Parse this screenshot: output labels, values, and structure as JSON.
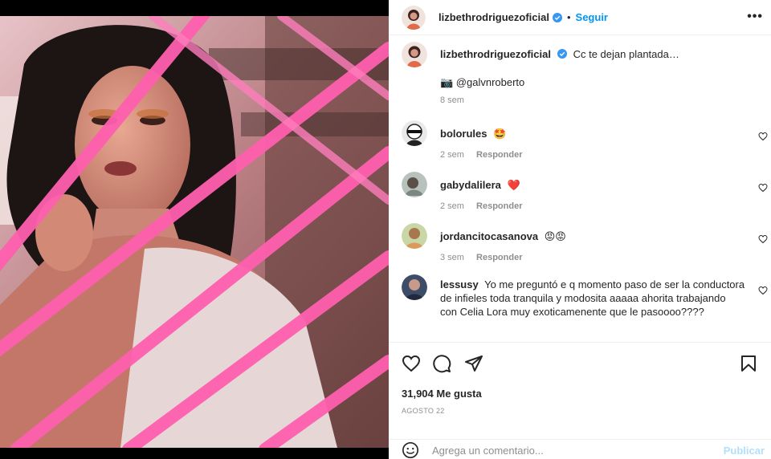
{
  "post": {
    "username": "lizbethrodriguezoficial",
    "follow_label": "Seguir",
    "more_label": "•••",
    "dot": "•"
  },
  "caption": {
    "username": "lizbethrodriguezoficial",
    "text": "Cc te dejan plantada…",
    "credit": "📷 @galvnroberto",
    "time": "8 sem"
  },
  "comments": [
    {
      "username": "bolorules",
      "text": "🤩",
      "time": "2 sem",
      "reply": "Responder"
    },
    {
      "username": "gabydalilera",
      "text": "❤️",
      "time": "2 sem",
      "reply": "Responder"
    },
    {
      "username": "jordancitocasanova",
      "text": "😡😡",
      "time": "3 sem",
      "reply": "Responder"
    },
    {
      "username": "lessusy",
      "text": "Yo me preguntó e q momento paso de ser la conductora de infieles toda tranquila y modosita aaaaa ahorita trabajando con Celia Lora muy exoticamenente que le pasoooo????",
      "time": "",
      "reply": ""
    }
  ],
  "footer": {
    "likes": "31,904 Me gusta",
    "date": "AGOSTO 22",
    "comment_placeholder": "Agrega un comentario...",
    "publish_label": "Publicar"
  },
  "colors": {
    "accent": "#0095f6",
    "publish_disabled": "#b2dffc",
    "muted": "#8e8e8e",
    "rail_pink": "#ff5fae"
  },
  "icons": {
    "like": "heart-outline-icon",
    "comment": "comment-bubble-icon",
    "share": "paper-plane-icon",
    "save": "bookmark-icon",
    "emoji": "smiley-icon",
    "verified": "verified-badge-icon"
  }
}
